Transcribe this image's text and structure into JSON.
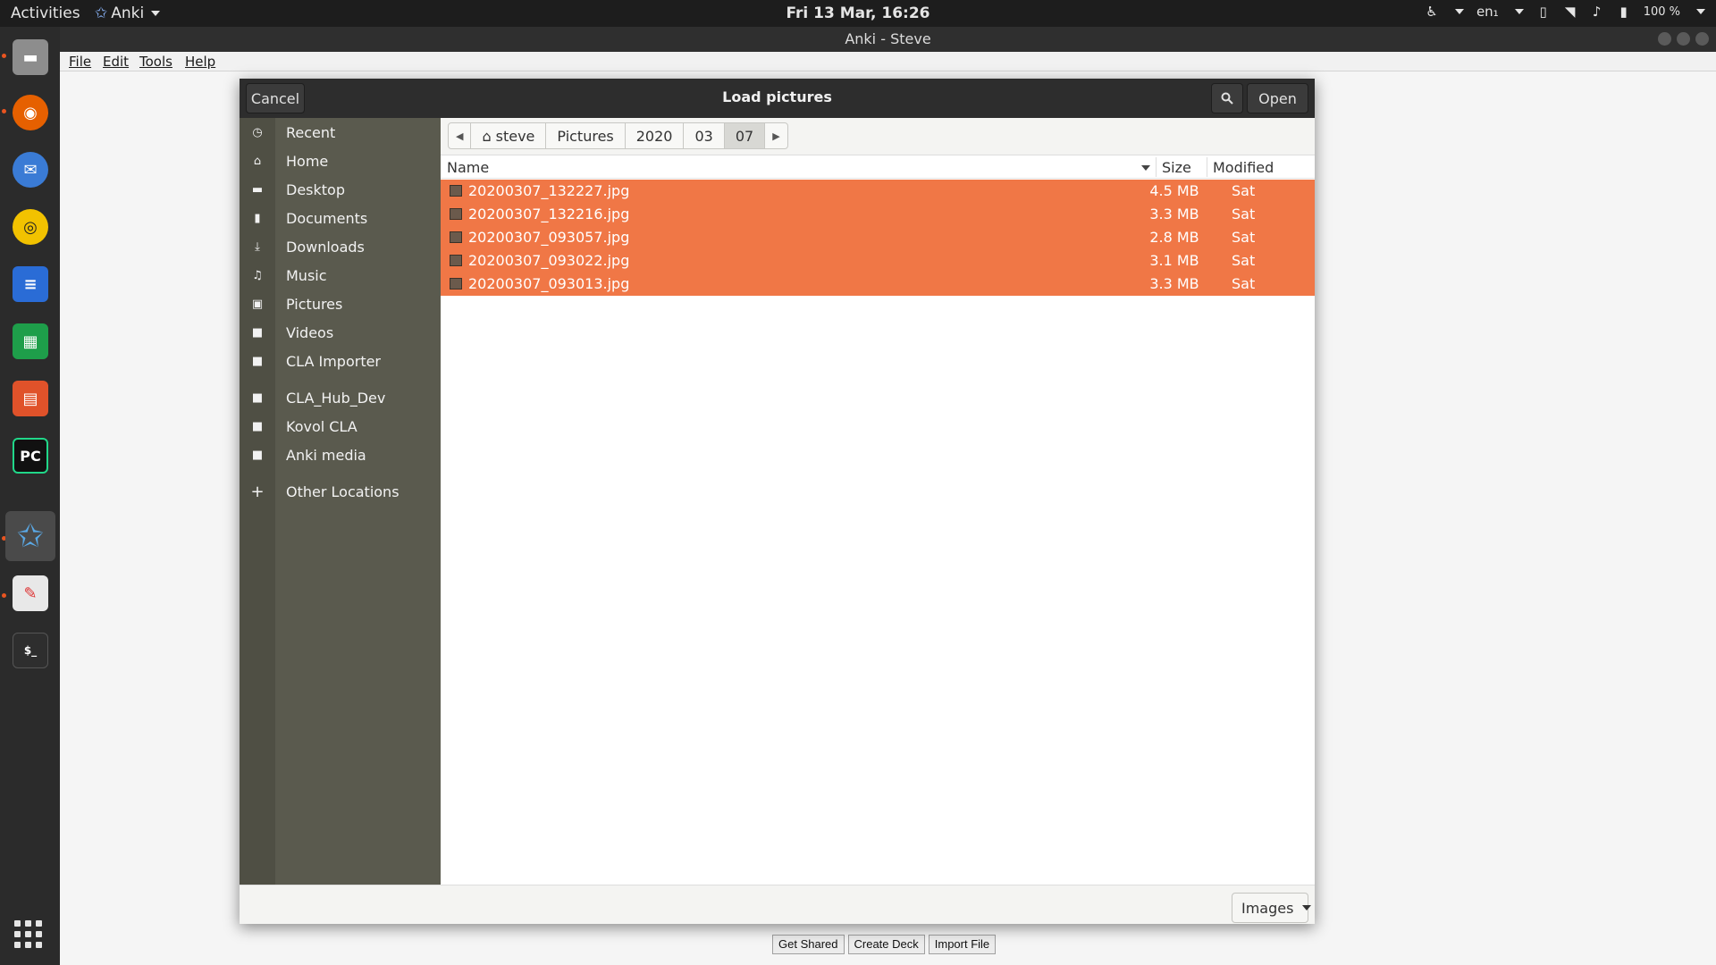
{
  "topbar": {
    "activities": "Activities",
    "app_name": "Anki",
    "clock": "Fri 13 Mar, 16:26",
    "language": "en₁",
    "battery": "100 %"
  },
  "dock": {
    "items": [
      "files-icon",
      "firefox-icon",
      "thunderbird-icon",
      "rhythmbox-icon",
      "writer-icon",
      "calc-icon",
      "impress-icon",
      "pycharm-icon",
      "anki-icon",
      "text-editor-icon",
      "terminal-icon"
    ]
  },
  "window": {
    "title": "Anki - Steve",
    "menu": {
      "file": "File",
      "edit": "Edit",
      "tools": "Tools",
      "help": "Help"
    },
    "bottom_buttons": {
      "get_shared": "Get Shared",
      "create_deck": "Create Deck",
      "import_file": "Import File"
    }
  },
  "dialog": {
    "title": "Load pictures",
    "cancel": "Cancel",
    "open": "Open",
    "sidebar": [
      {
        "label": "Recent",
        "icon": "clock-icon"
      },
      {
        "label": "Home",
        "icon": "home-icon"
      },
      {
        "label": "Desktop",
        "icon": "desktop-icon"
      },
      {
        "label": "Documents",
        "icon": "document-icon"
      },
      {
        "label": "Downloads",
        "icon": "download-icon"
      },
      {
        "label": "Music",
        "icon": "music-icon"
      },
      {
        "label": "Pictures",
        "icon": "pictures-icon"
      },
      {
        "label": "Videos",
        "icon": "video-icon"
      },
      {
        "label": "CLA Importer",
        "icon": "folder-icon"
      },
      {
        "label": "CLA_Hub_Dev",
        "icon": "folder-icon"
      },
      {
        "label": "Kovol CLA",
        "icon": "folder-icon"
      },
      {
        "label": "Anki media",
        "icon": "folder-icon"
      },
      {
        "label": "Other Locations",
        "icon": "plus-icon"
      }
    ],
    "path": [
      "steve",
      "Pictures",
      "2020",
      "03",
      "07"
    ],
    "columns": {
      "name": "Name",
      "size": "Size",
      "modified": "Modified"
    },
    "files": [
      {
        "name": "20200307_132227.jpg",
        "size": "4.5 MB",
        "modified": "Sat"
      },
      {
        "name": "20200307_132216.jpg",
        "size": "3.3 MB",
        "modified": "Sat"
      },
      {
        "name": "20200307_093057.jpg",
        "size": "2.8 MB",
        "modified": "Sat"
      },
      {
        "name": "20200307_093022.jpg",
        "size": "3.1 MB",
        "modified": "Sat"
      },
      {
        "name": "20200307_093013.jpg",
        "size": "3.3 MB",
        "modified": "Sat"
      }
    ],
    "filter": "Images",
    "selection_color": "#f07746"
  }
}
